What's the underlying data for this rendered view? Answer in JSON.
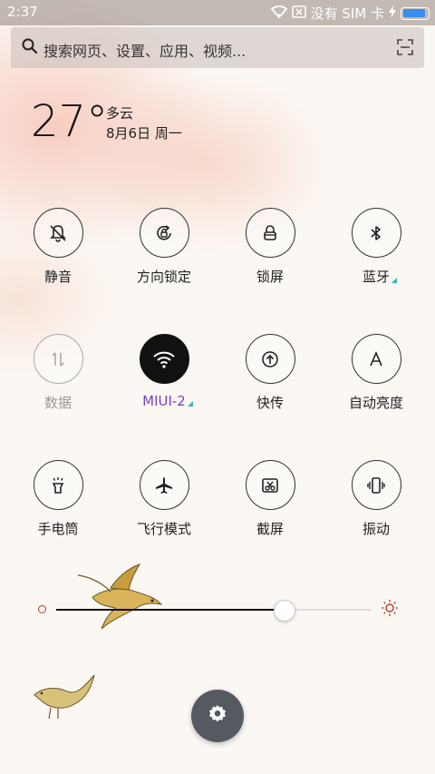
{
  "status_bar": {
    "time": "2:37",
    "carrier": "没有 SIM 卡",
    "battery_level": 0.9
  },
  "search": {
    "placeholder": "搜索网页、设置、应用、视频..."
  },
  "weather": {
    "temperature": "27°",
    "condition": "多云",
    "date": "8月6日 周一"
  },
  "toggles": [
    {
      "label": "静音",
      "icon": "bell-off-icon",
      "state": "off"
    },
    {
      "label": "方向锁定",
      "icon": "rotation-lock-icon",
      "state": "off"
    },
    {
      "label": "锁屏",
      "icon": "lock-icon",
      "state": "off"
    },
    {
      "label": "蓝牙",
      "icon": "bluetooth-icon",
      "state": "off"
    },
    {
      "label": "数据",
      "icon": "mobile-data-icon",
      "state": "disabled"
    },
    {
      "label": "MIUI-2",
      "icon": "wifi-icon",
      "state": "on"
    },
    {
      "label": "快传",
      "icon": "quick-transfer-icon",
      "state": "off"
    },
    {
      "label": "自动亮度",
      "icon": "auto-brightness-icon",
      "state": "off"
    },
    {
      "label": "手电筒",
      "icon": "flashlight-icon",
      "state": "off"
    },
    {
      "label": "飞行模式",
      "icon": "airplane-icon",
      "state": "off"
    },
    {
      "label": "截屏",
      "icon": "screenshot-icon",
      "state": "off"
    },
    {
      "label": "振动",
      "icon": "vibrate-icon",
      "state": "off"
    }
  ],
  "brightness": {
    "level": 0.72
  },
  "colors": {
    "accent_text": "#7a3fbf",
    "active_tile": "#111111",
    "corner_marker": "#3bb3b0",
    "battery": "#3b8df1"
  }
}
